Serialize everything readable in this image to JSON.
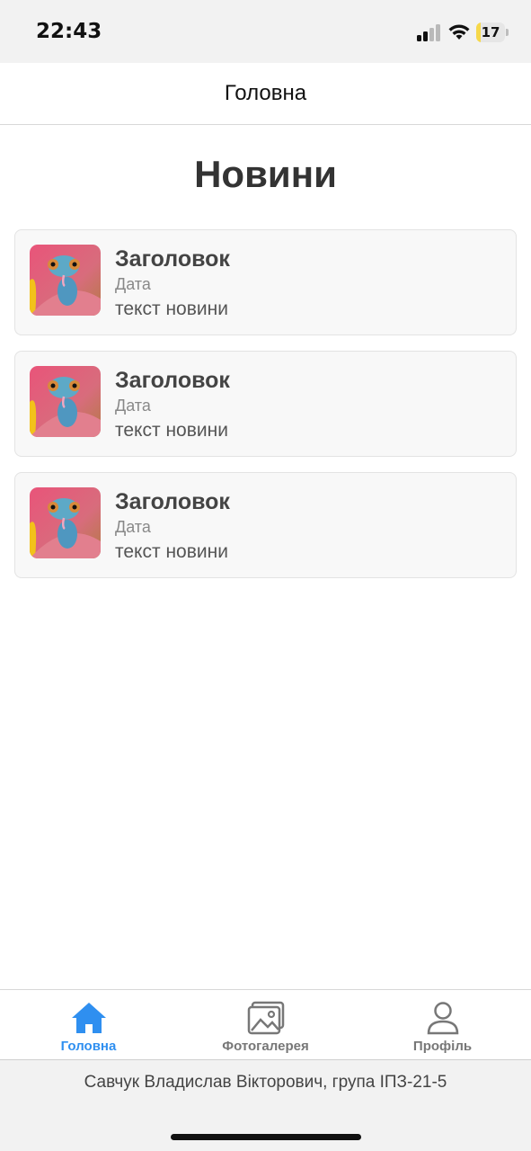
{
  "status_bar": {
    "time": "22:43",
    "battery_level": "17",
    "battery_fraction": 0.17,
    "battery_color": "#f6d84a",
    "icons": [
      "signal-icon",
      "wifi-icon",
      "battery-icon"
    ]
  },
  "header": {
    "title": "Головна"
  },
  "main": {
    "heading": "Новини",
    "news": [
      {
        "title": "Заголовок",
        "date": "Дата",
        "text": "текст новини",
        "image": "chameleon-thumbnail"
      },
      {
        "title": "Заголовок",
        "date": "Дата",
        "text": "текст новини",
        "image": "chameleon-thumbnail"
      },
      {
        "title": "Заголовок",
        "date": "Дата",
        "text": "текст новини",
        "image": "chameleon-thumbnail"
      }
    ]
  },
  "tabs": [
    {
      "label": "Головна",
      "icon": "home-icon",
      "active": true
    },
    {
      "label": "Фотогалерея",
      "icon": "gallery-icon",
      "active": false
    },
    {
      "label": "Профіль",
      "icon": "profile-icon",
      "active": false
    }
  ],
  "colors": {
    "accent": "#2f8ff0",
    "inactive": "#777777"
  },
  "footer": {
    "text": "Савчук Владислав Вікторович, група ІПЗ-21-5"
  }
}
